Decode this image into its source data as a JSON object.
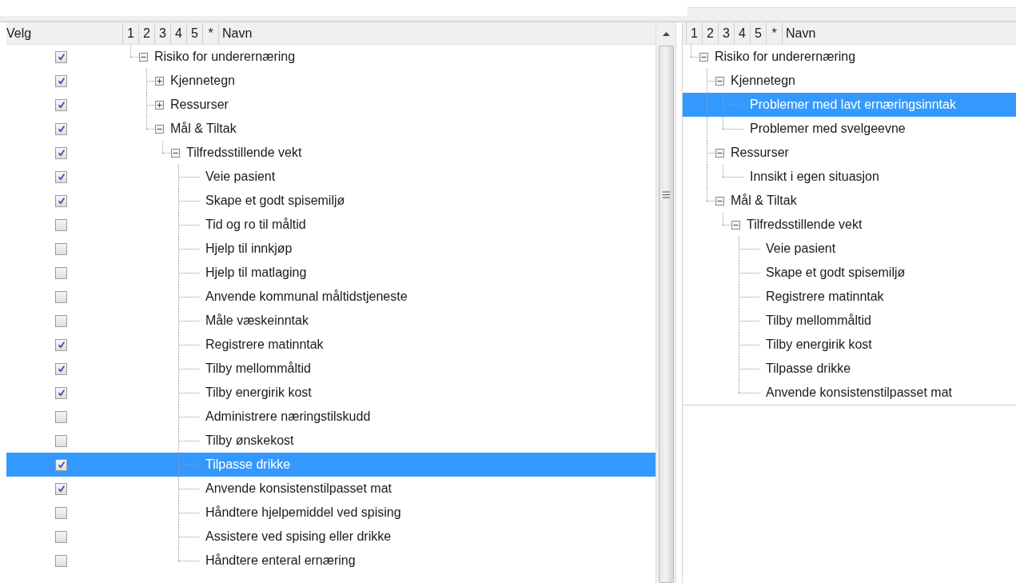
{
  "left_panel": {
    "check_header": "Velg",
    "level_columns": [
      "1",
      "2",
      "3",
      "4",
      "5",
      "*"
    ],
    "name_header": "Navn",
    "tree": [
      {
        "label": "Risiko for underernæring",
        "checked": true,
        "selected": false,
        "expanded": true,
        "children": [
          {
            "label": "Kjennetegn",
            "checked": true,
            "selected": false,
            "expanded": false
          },
          {
            "label": "Ressurser",
            "checked": true,
            "selected": false,
            "expanded": false
          },
          {
            "label": "Mål & Tiltak",
            "checked": true,
            "selected": false,
            "expanded": true,
            "children": [
              {
                "label": "Tilfredsstillende vekt",
                "checked": true,
                "selected": false,
                "expanded": true,
                "children": [
                  {
                    "label": "Veie pasient",
                    "checked": true,
                    "selected": false
                  },
                  {
                    "label": "Skape et godt spisemiljø",
                    "checked": true,
                    "selected": false
                  },
                  {
                    "label": "Tid og ro til måltid",
                    "checked": false,
                    "selected": false
                  },
                  {
                    "label": "Hjelp til innkjøp",
                    "checked": false,
                    "selected": false
                  },
                  {
                    "label": "Hjelp til matlaging",
                    "checked": false,
                    "selected": false
                  },
                  {
                    "label": "Anvende kommunal måltidstjeneste",
                    "checked": false,
                    "selected": false
                  },
                  {
                    "label": "Måle væskeinntak",
                    "checked": false,
                    "selected": false
                  },
                  {
                    "label": "Registrere matinntak",
                    "checked": true,
                    "selected": false
                  },
                  {
                    "label": "Tilby mellommåltid",
                    "checked": true,
                    "selected": false
                  },
                  {
                    "label": "Tilby energirik kost",
                    "checked": true,
                    "selected": false
                  },
                  {
                    "label": "Administrere næringstilskudd",
                    "checked": false,
                    "selected": false
                  },
                  {
                    "label": "Tilby ønskekost",
                    "checked": false,
                    "selected": false
                  },
                  {
                    "label": "Tilpasse drikke",
                    "checked": true,
                    "selected": true
                  },
                  {
                    "label": "Anvende konsistenstilpasset mat",
                    "checked": true,
                    "selected": false
                  },
                  {
                    "label": "Håndtere hjelpemiddel ved spising",
                    "checked": false,
                    "selected": false
                  },
                  {
                    "label": "Assistere ved spising eller drikke",
                    "checked": false,
                    "selected": false
                  },
                  {
                    "label": "Håndtere enteral ernæring",
                    "checked": false,
                    "selected": false
                  }
                ]
              }
            ]
          }
        ]
      }
    ]
  },
  "right_panel": {
    "level_columns": [
      "1",
      "2",
      "3",
      "4",
      "5",
      "*"
    ],
    "name_header": "Navn",
    "tree": [
      {
        "label": "Risiko for underernæring",
        "selected": false,
        "expanded": true,
        "children": [
          {
            "label": "Kjennetegn",
            "selected": false,
            "expanded": true,
            "children": [
              {
                "label": "Problemer med lavt ernæringsinntak",
                "selected": true
              },
              {
                "label": "Problemer med svelgeevne",
                "selected": false
              }
            ]
          },
          {
            "label": "Ressurser",
            "selected": false,
            "expanded": true,
            "children": [
              {
                "label": "Innsikt i egen situasjon",
                "selected": false
              }
            ]
          },
          {
            "label": "Mål & Tiltak",
            "selected": false,
            "expanded": true,
            "children": [
              {
                "label": "Tilfredsstillende vekt",
                "selected": false,
                "expanded": true,
                "children": [
                  {
                    "label": "Veie pasient",
                    "selected": false
                  },
                  {
                    "label": "Skape et godt spisemiljø",
                    "selected": false
                  },
                  {
                    "label": "Registrere matinntak",
                    "selected": false
                  },
                  {
                    "label": "Tilby mellommåltid",
                    "selected": false
                  },
                  {
                    "label": "Tilby energirik kost",
                    "selected": false
                  },
                  {
                    "label": "Tilpasse drikke",
                    "selected": false
                  },
                  {
                    "label": "Anvende konsistenstilpasset mat",
                    "selected": false
                  }
                ]
              }
            ]
          }
        ]
      }
    ]
  }
}
